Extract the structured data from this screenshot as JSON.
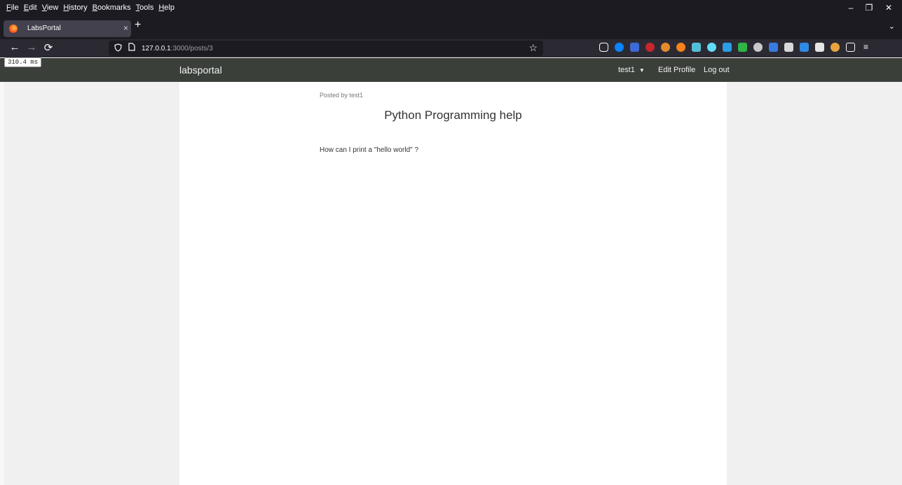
{
  "menubar": {
    "items": [
      "File",
      "Edit",
      "View",
      "History",
      "Bookmarks",
      "Tools",
      "Help"
    ]
  },
  "window_controls": {
    "minimize": "–",
    "restore": "❐",
    "close": "✕"
  },
  "tab": {
    "title": "LabsPortal",
    "close": "×"
  },
  "newtab": "+",
  "listall": "⌄",
  "nav": {
    "back": "←",
    "forward": "→",
    "reload": "⟳"
  },
  "url": {
    "host": "127.0.0.1",
    "path": ":3000/posts/3"
  },
  "icons": {
    "shield": "shield-icon",
    "page": "page-icon",
    "star": "star-icon"
  },
  "timing": "310.4 ms",
  "site": {
    "brand": "labsportal",
    "user": "test1",
    "edit_profile": "Edit Profile",
    "logout": "Log out"
  },
  "post": {
    "posted_by": "Posted by test1",
    "title": "Python Programming help",
    "body": "How can I print a \"hello world\" ?"
  },
  "colors": {
    "chrome_dark": "#1c1b22",
    "tab_active": "#42414d",
    "site_nav": "#3a3f3a",
    "page_bg": "#f0f0f0"
  }
}
